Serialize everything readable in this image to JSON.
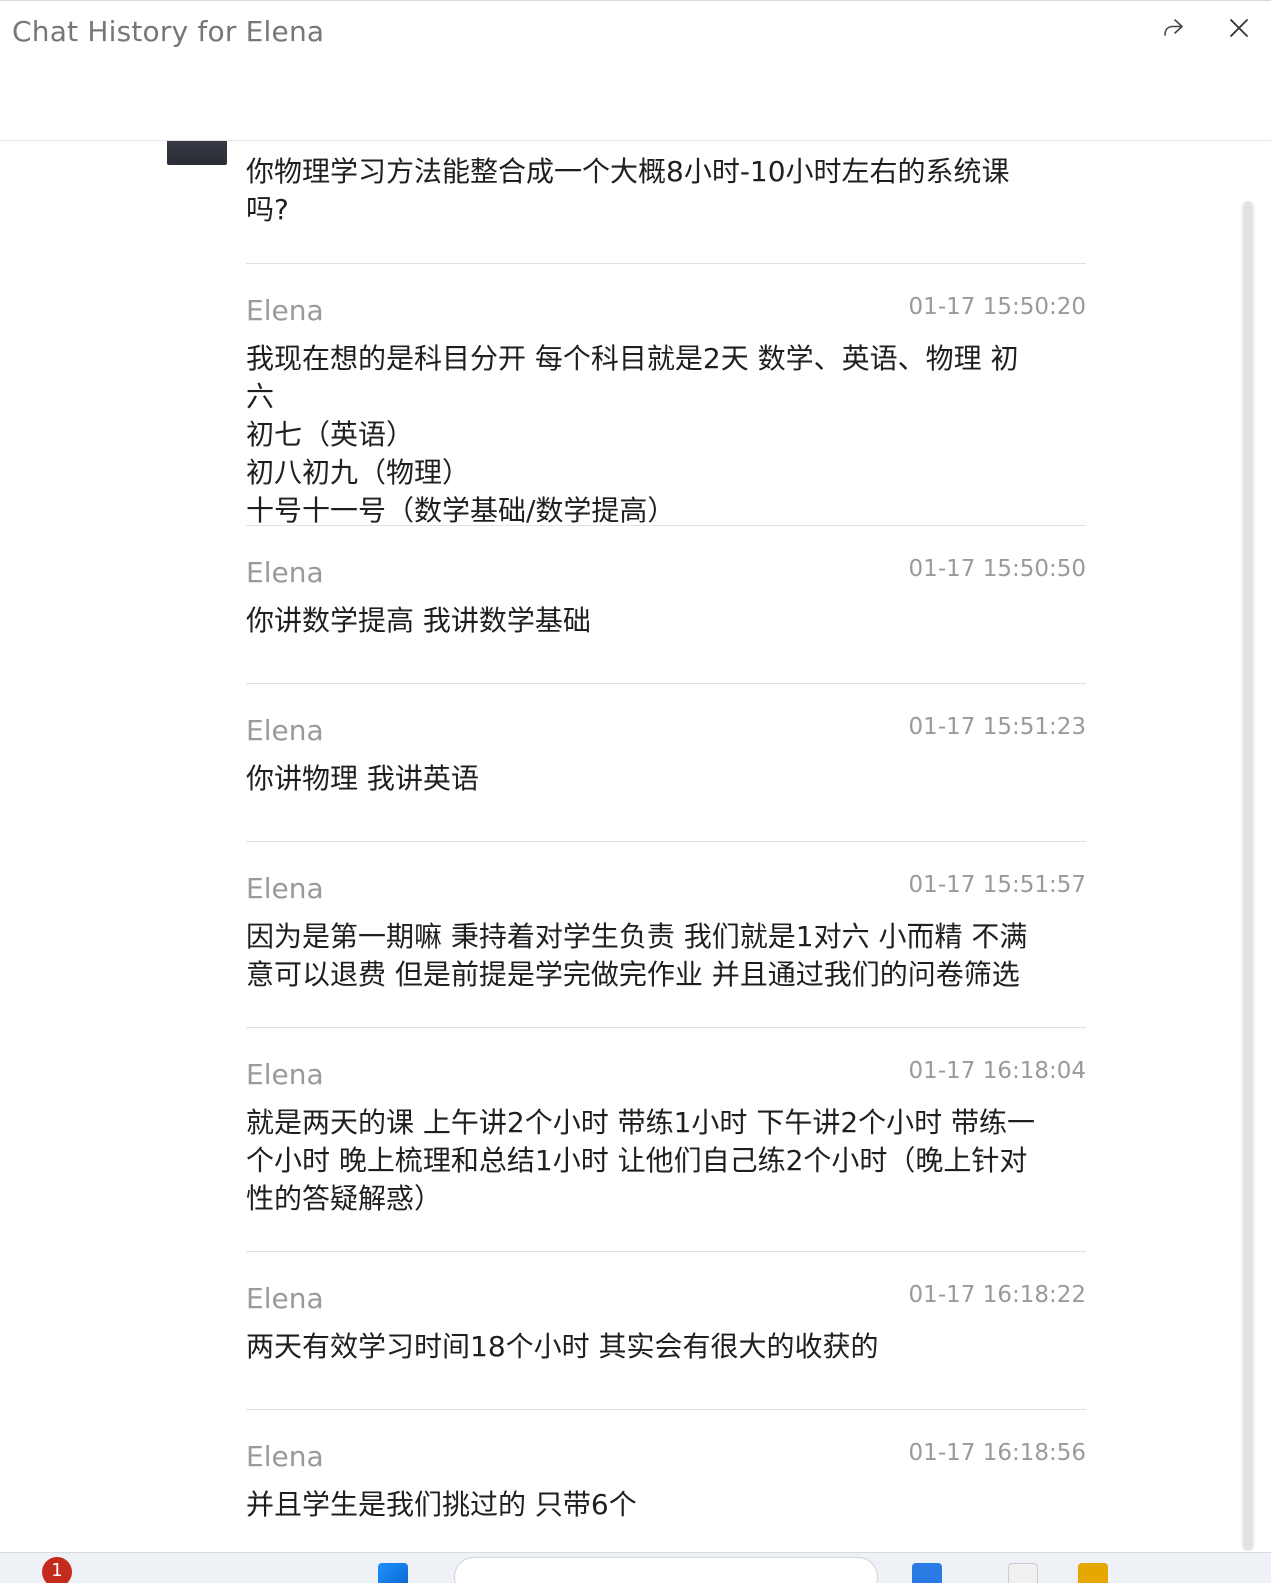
{
  "window": {
    "title": "Chat History for Elena",
    "share_icon": "share-icon",
    "close_icon": "close-icon"
  },
  "first_message": {
    "text": "你物理学习方法能整合成一个大概8小时-10小时左右的系统课\n吗?"
  },
  "messages": [
    {
      "sender": "Elena",
      "time": "01-17 15:50:20",
      "text": "我现在想的是科目分开 每个科目就是2天 数学、英语、物理 初六\n初七（英语）\n初八初九（物理）\n十号十一号（数学基础/数学提高）"
    },
    {
      "sender": "Elena",
      "time": "01-17 15:50:50",
      "text": "你讲数学提高 我讲数学基础"
    },
    {
      "sender": "Elena",
      "time": "01-17 15:51:23",
      "text": "你讲物理 我讲英语"
    },
    {
      "sender": "Elena",
      "time": "01-17 15:51:57",
      "text": "因为是第一期嘛 秉持着对学生负责 我们就是1对六 小而精 不满\n意可以退费 但是前提是学完做完作业 并且通过我们的问卷筛选"
    },
    {
      "sender": "Elena",
      "time": "01-17 16:18:04",
      "text": "就是两天的课 上午讲2个小时 带练1小时 下午讲2个小时 带练一\n个小时 晚上梳理和总结1小时 让他们自己练2个小时（晚上针对\n性的答疑解惑）"
    },
    {
      "sender": "Elena",
      "time": "01-17 16:18:22",
      "text": "两天有效学习时间18个小时 其实会有很大的收获的"
    },
    {
      "sender": "Elena",
      "time": "01-17 16:18:56",
      "text": "并且学生是我们挑过的 只带6个"
    }
  ],
  "taskbar": {
    "notification_count": "1"
  }
}
